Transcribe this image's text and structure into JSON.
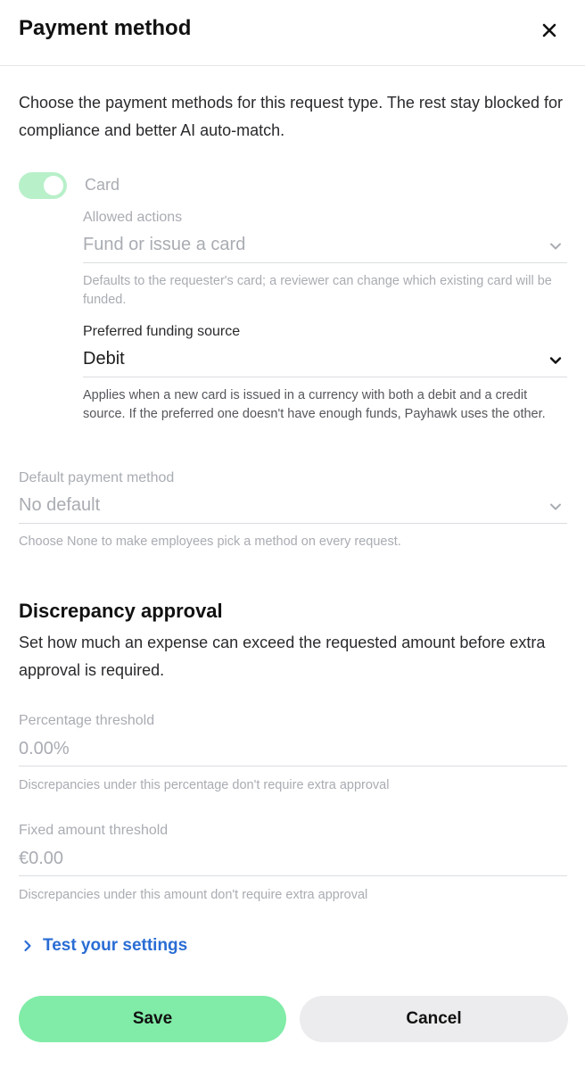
{
  "header": {
    "title": "Payment method",
    "close_icon": "close-icon"
  },
  "intro": "Choose the payment methods for this request type. The rest stay blocked for compliance and better AI auto-match.",
  "card": {
    "toggle_on": true,
    "label": "Card",
    "allowed_actions": {
      "label": "Allowed actions",
      "value": "Fund or issue a card",
      "help": "Defaults to the requester's card; a reviewer can change which existing card will be funded."
    },
    "funding_source": {
      "label": "Preferred funding source",
      "value": "Debit",
      "help": "Applies when a new card is issued in a currency with both a debit and a credit source. If the preferred one doesn't have enough funds, Payhawk uses the other."
    }
  },
  "default_payment": {
    "label": "Default payment method",
    "value": "No default",
    "help": "Choose None to make employees pick a method on every request."
  },
  "discrepancy": {
    "title": "Discrepancy approval",
    "description": "Set how much an expense can exceed the requested amount before extra approval is required.",
    "percentage": {
      "label": "Percentage threshold",
      "placeholder": "0.00%",
      "help": "Discrepancies under this percentage don't require extra approval"
    },
    "fixed": {
      "label": "Fixed amount threshold",
      "placeholder": "€0.00",
      "help": "Discrepancies under this amount don't require extra approval"
    }
  },
  "test_link": {
    "label": "Test your settings",
    "icon": "chevron-right-icon"
  },
  "actions": {
    "save": "Save",
    "cancel": "Cancel"
  },
  "colors": {
    "accent_green": "#80eca7",
    "toggle_green": "#b8f0c9",
    "link_blue": "#2a6dd4"
  }
}
